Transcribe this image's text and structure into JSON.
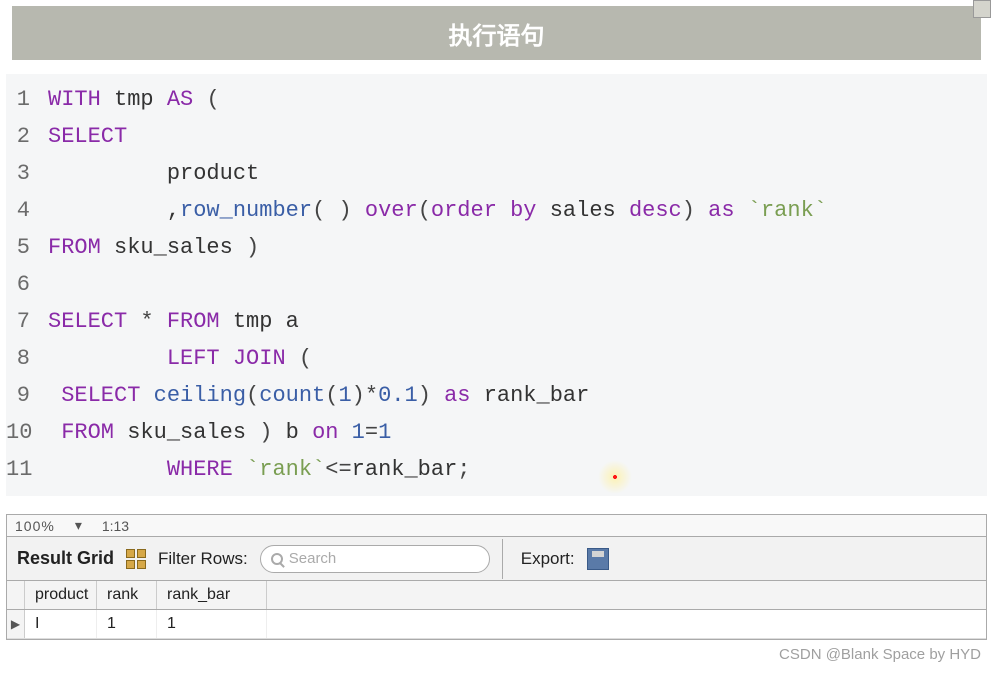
{
  "header": {
    "title": "执行语句"
  },
  "code": {
    "lines": [
      {
        "n": "1",
        "tokens": [
          [
            "kw",
            "WITH"
          ],
          [
            "txt",
            " tmp "
          ],
          [
            "kw",
            "AS"
          ],
          [
            "txt",
            " "
          ],
          [
            "paren",
            "("
          ]
        ]
      },
      {
        "n": "2",
        "tokens": [
          [
            "kw",
            "SELECT"
          ]
        ]
      },
      {
        "n": "3",
        "tokens": [
          [
            "txt",
            "         product"
          ]
        ]
      },
      {
        "n": "4",
        "tokens": [
          [
            "txt",
            "         ,"
          ],
          [
            "fn",
            "row_number"
          ],
          [
            "paren",
            "("
          ],
          [
            "txt",
            " "
          ],
          [
            "paren",
            ")"
          ],
          [
            "txt",
            " "
          ],
          [
            "kw",
            "over"
          ],
          [
            "paren",
            "("
          ],
          [
            "kw",
            "order by"
          ],
          [
            "txt",
            " sales "
          ],
          [
            "kw",
            "desc"
          ],
          [
            "paren",
            ")"
          ],
          [
            "txt",
            " "
          ],
          [
            "kw",
            "as"
          ],
          [
            "txt",
            " "
          ],
          [
            "bt",
            "`rank`"
          ]
        ]
      },
      {
        "n": "5",
        "tokens": [
          [
            "kw",
            "FROM"
          ],
          [
            "txt",
            " sku_sales "
          ],
          [
            "paren",
            ")"
          ]
        ]
      },
      {
        "n": "6",
        "tokens": [
          [
            "txt",
            ""
          ]
        ]
      },
      {
        "n": "7",
        "tokens": [
          [
            "kw",
            "SELECT"
          ],
          [
            "txt",
            " "
          ],
          [
            "op",
            "*"
          ],
          [
            "txt",
            " "
          ],
          [
            "kw",
            "FROM"
          ],
          [
            "txt",
            " tmp a"
          ]
        ]
      },
      {
        "n": "8",
        "tokens": [
          [
            "txt",
            "         "
          ],
          [
            "kw",
            "LEFT JOIN"
          ],
          [
            "txt",
            " "
          ],
          [
            "paren",
            "("
          ]
        ]
      },
      {
        "n": "9",
        "tokens": [
          [
            "txt",
            " "
          ],
          [
            "kw",
            "SELECT"
          ],
          [
            "txt",
            " "
          ],
          [
            "fn",
            "ceiling"
          ],
          [
            "paren",
            "("
          ],
          [
            "fn",
            "count"
          ],
          [
            "paren",
            "("
          ],
          [
            "num",
            "1"
          ],
          [
            "paren",
            ")"
          ],
          [
            "op",
            "*"
          ],
          [
            "num",
            "0.1"
          ],
          [
            "paren",
            ")"
          ],
          [
            "txt",
            " "
          ],
          [
            "kw",
            "as"
          ],
          [
            "txt",
            " rank_bar"
          ]
        ]
      },
      {
        "n": "10",
        "tokens": [
          [
            "txt",
            " "
          ],
          [
            "kw",
            "FROM"
          ],
          [
            "txt",
            " sku_sales "
          ],
          [
            "paren",
            ")"
          ],
          [
            "txt",
            " b "
          ],
          [
            "kw",
            "on"
          ],
          [
            "txt",
            " "
          ],
          [
            "num",
            "1"
          ],
          [
            "op",
            "="
          ],
          [
            "num",
            "1"
          ]
        ]
      },
      {
        "n": "11",
        "tokens": [
          [
            "txt",
            "         "
          ],
          [
            "kw",
            "WHERE"
          ],
          [
            "txt",
            " "
          ],
          [
            "bt",
            "`rank`"
          ],
          [
            "op",
            "<="
          ],
          [
            "txt",
            "rank_bar"
          ],
          [
            "op",
            ";"
          ]
        ]
      }
    ]
  },
  "toolbar": {
    "zoom": "100%",
    "time": "1:13"
  },
  "result": {
    "grid_label": "Result Grid",
    "filter_label": "Filter Rows:",
    "search_placeholder": "Search",
    "export_label": "Export:",
    "columns": [
      "product",
      "rank",
      "rank_bar"
    ],
    "rows": [
      {
        "product": "I",
        "rank": "1",
        "rank_bar": "1"
      }
    ]
  },
  "watermark": "CSDN @Blank Space by HYD"
}
